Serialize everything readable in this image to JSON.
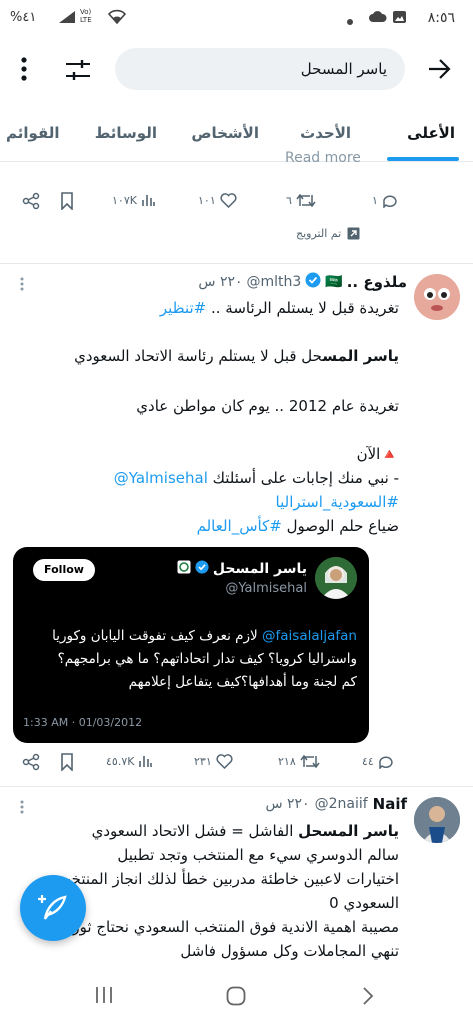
{
  "status": {
    "time": "٨:٥٦",
    "battery": "%٤١",
    "network": "Vo) LTE"
  },
  "search": {
    "query": "ياسر المسحل"
  },
  "tabs": [
    "الأعلى",
    "الأحدث",
    "الأشخاص",
    "الوسائط",
    "القوائم"
  ],
  "promo_tweet": {
    "partial_text": "Read more",
    "replies": "١",
    "retweets": "٦",
    "likes": "١٠١",
    "views": "١٠٧K",
    "promoted_label": "تم الترويج"
  },
  "tweet1": {
    "name": "ملذوع ..",
    "flag": "🇸🇦",
    "handle": "@mlth3",
    "time": "٢٢٠ س",
    "line1_text": "تغريدة  قبل لا يستلم الرئاسة  .. ",
    "line1_hashtag": "#تنظير",
    "line2_bold": "ياسر المس",
    "line2_rest": "حل قبل لا يستلم رئاسة الاتحاد السعودي",
    "line3": "تغريدة عام 2012 .. يوم كان مواطن عادي",
    "line4": "🔺الآن",
    "line5_text": "- نبي منك إجابات على أسئلتك ",
    "line5_mention": "@Yalmisehal",
    "line6_hashtag": "#السعودية_استراليا",
    "line7_text": "ضياع حلم الوصول ",
    "line7_hashtag": "#كأس_العالم",
    "embed": {
      "name": "ياسر المسحل",
      "handle": "@Yalmisehal",
      "follow": "Follow",
      "mention": "@faisalaljafan",
      "text1": " لازم نعرف كيف تفوقت اليابان وكوريا",
      "text2": "واستراليا كرويا؟ كيف تدار اتحاداتهم؟ ما هي برامجهم؟",
      "text3": "كم لجنة وما أهدافها؟كيف يتفاعل إعلامهم",
      "date": "1:33 AM · 01/03/2012"
    },
    "replies": "٤٤",
    "retweets": "٢١٨",
    "likes": "٢٣١",
    "views": "٤٥.٧K"
  },
  "tweet2": {
    "name": "Naif",
    "handle": "@2naiif",
    "time": "٢٢٠ س",
    "line1_bold": "ياسر المسحل",
    "line1_rest": " الفاشل = فشل الاتحاد السعودي",
    "line2": "سالم الدوسري سيء مع المنتخب وتجد تطبيل",
    "line3": "اختيارات لاعبين خاطئة مدربين خطأ لذلك انجاز المنتخب",
    "line4": "السعودي 0",
    "line5": "مصيبة اهمية الاندية فوق المنتخب السعودي نحتاج ثورة",
    "line6": "تنهي المجاملات وكل مسؤول فاشل"
  },
  "colors": {
    "accent": "#1d9bf0",
    "text": "#0f1419",
    "muted": "#536471"
  }
}
